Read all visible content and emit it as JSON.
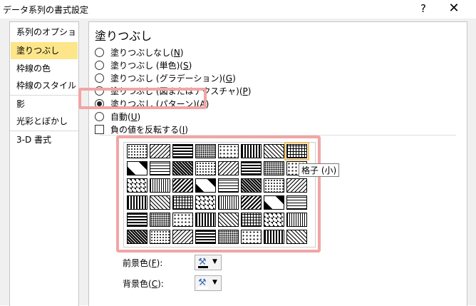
{
  "window": {
    "title": "データ系列の書式設定",
    "help": "?",
    "close": "✕"
  },
  "sidebar": {
    "items": [
      {
        "label": "系列のオプション"
      },
      {
        "label": "塗りつぶし",
        "selected": true
      },
      {
        "label": "枠線の色"
      },
      {
        "label": "枠線のスタイル"
      },
      {
        "label": "影"
      },
      {
        "label": "光彩とぼかし"
      },
      {
        "label": "3-D 書式"
      }
    ]
  },
  "fill": {
    "heading": "塗りつぶし",
    "options": [
      {
        "label": "塗りつぶしなし(",
        "key": "N",
        "tail": ")",
        "checked": false
      },
      {
        "label": "塗りつぶし (単色)(",
        "key": "S",
        "tail": ")",
        "checked": false
      },
      {
        "label": "塗りつぶし (グラデーション)(",
        "key": "G",
        "tail": ")",
        "checked": false
      },
      {
        "label": "塗りつぶし (図またはテクスチャ)(",
        "key": "P",
        "tail": ")",
        "checked": false
      },
      {
        "label": "塗りつぶし (パターン)(",
        "key": "A",
        "tail": ")",
        "checked": true
      },
      {
        "label": "自動(",
        "key": "U",
        "tail": ")",
        "checked": false
      }
    ],
    "invert": {
      "label": "負の値を反転する(",
      "key": "I",
      "tail": ")",
      "checked": false
    }
  },
  "pattern": {
    "rows": 6,
    "cols": 8,
    "selected_index": 7,
    "tooltip": "格子 (小)"
  },
  "colors": {
    "foreground": {
      "label": "前景色(",
      "key": "F",
      "tail": "):",
      "value": "#000000"
    },
    "background": {
      "label": "背景色(",
      "key": "C",
      "tail": "):",
      "value": "#ffffff"
    }
  },
  "accent": {
    "selection": "#fde58a",
    "highlight": "#f2a5a5"
  }
}
